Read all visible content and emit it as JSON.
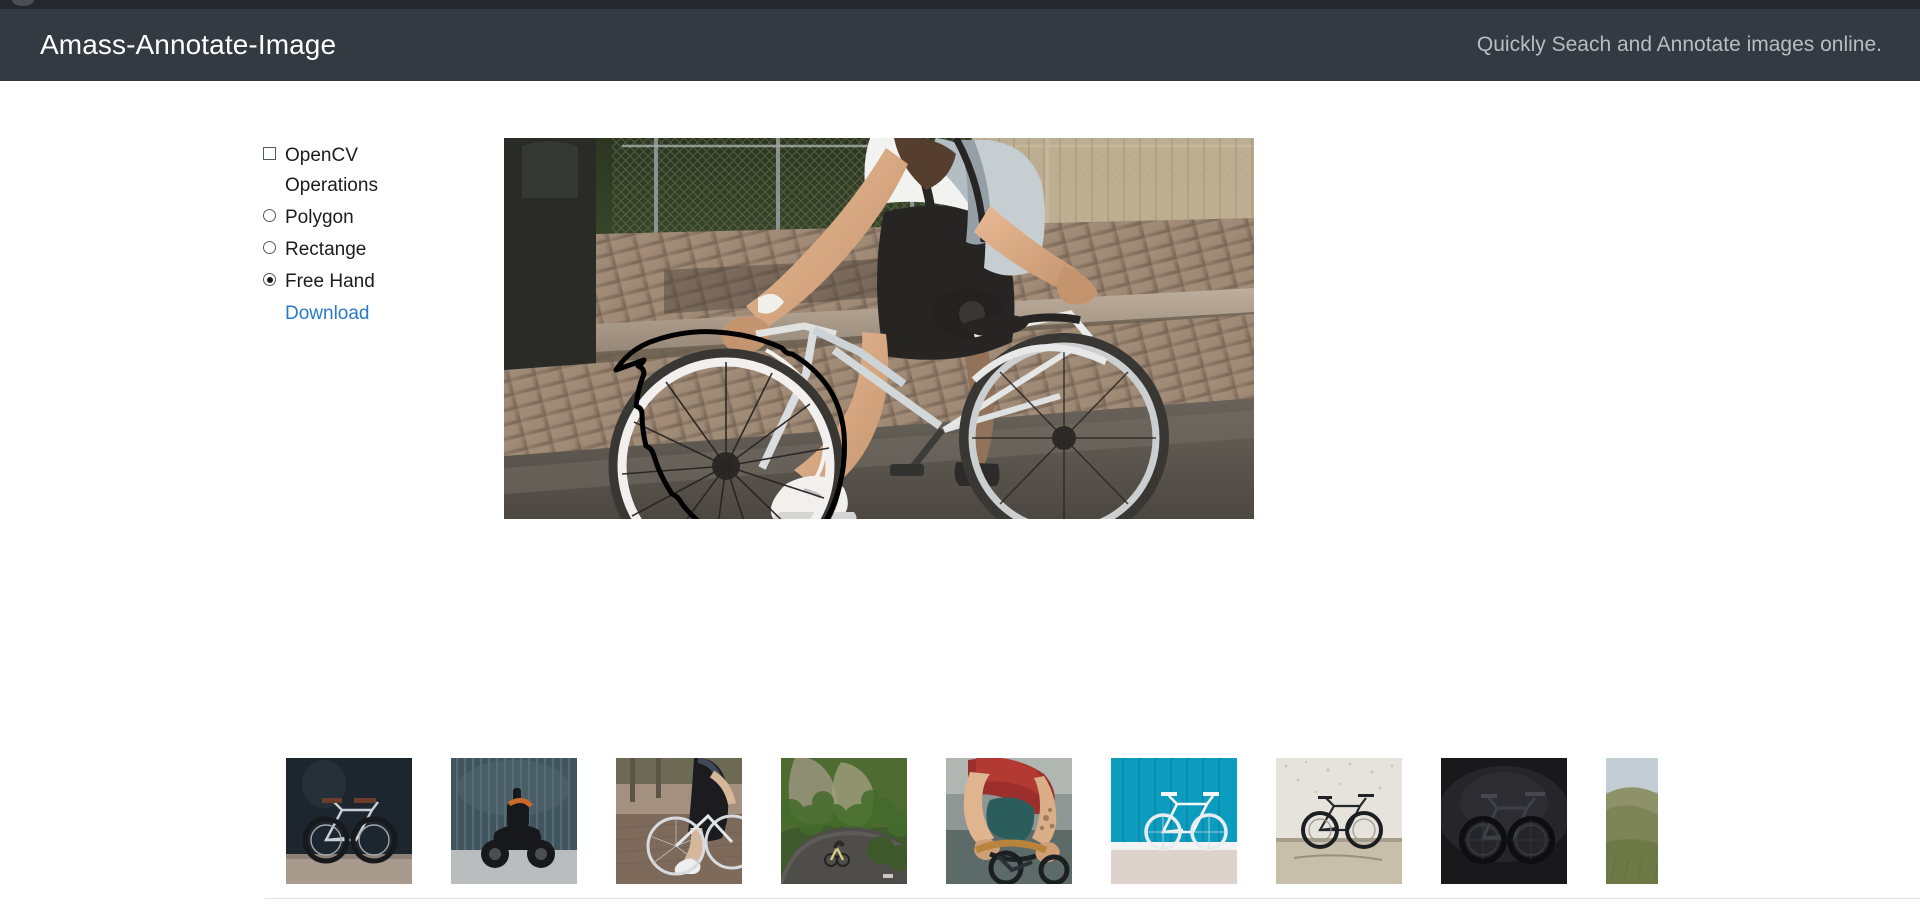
{
  "browser": {
    "tab_indicator": "tab-dot"
  },
  "header": {
    "title": "Amass-Annotate-Image",
    "tagline": "Quickly Seach and Annotate images online.",
    "background": "#343a42",
    "title_color": "#ffffff",
    "tagline_color": "#b9bcc1"
  },
  "tools": {
    "opencv": {
      "label": "OpenCV Operations",
      "type": "checkbox",
      "checked": false
    },
    "shapes": [
      {
        "label": "Polygon",
        "type": "radio",
        "checked": false
      },
      {
        "label": "Rectange",
        "type": "radio",
        "checked": false
      },
      {
        "label": "Free Hand",
        "type": "radio",
        "checked": true
      }
    ],
    "download": {
      "label": "Download",
      "color": "#2a7ac9"
    }
  },
  "canvas": {
    "alt": "Woman riding a light blue city bicycle on cobblestone path, wearing black skirt and white sneakers, with a backpack and camera strap",
    "annotation_mode": "Free Hand",
    "annotation_color": "#000000",
    "annotation_description": "Hand drawn black outline traced around the front bicycle wheel"
  },
  "thumbnails": [
    {
      "alt": "Silver road bicycle against dark navy wall"
    },
    {
      "alt": "Dark electric motorcycle in front of ribbed metal wall"
    },
    {
      "alt": "Cyclist on cobblestone path beside railing"
    },
    {
      "alt": "Cyclist riding on winding road through green mossy cliffs"
    },
    {
      "alt": "Cyclist in red shirt leaning over handlebars"
    },
    {
      "alt": "White bicycle leaning on teal wooden wall"
    },
    {
      "alt": "Road bicycle against white textured concrete wall"
    },
    {
      "alt": "Black road bicycle on black studio background"
    },
    {
      "alt": "Bicycle resting on grassy coastal hillside"
    }
  ]
}
